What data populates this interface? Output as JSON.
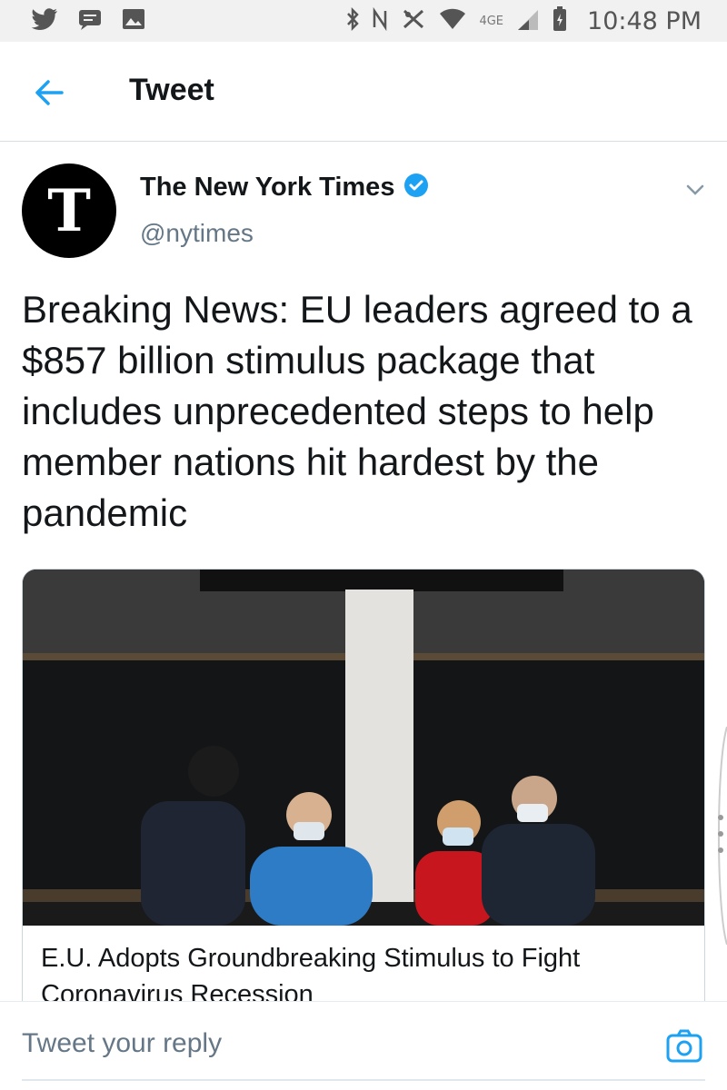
{
  "status_bar": {
    "time": "10:48 PM",
    "network": "4GE",
    "left_icons": [
      "twitter-bird-icon",
      "message-icon",
      "image-icon"
    ],
    "right_icons": [
      "bluetooth-icon",
      "nfc-icon",
      "mute-icon",
      "wifi-icon",
      "signal-icon",
      "battery-icon"
    ]
  },
  "header": {
    "title": "Tweet",
    "back_icon": "back-arrow-icon"
  },
  "tweet": {
    "author_name": "The New York Times",
    "handle": "@nytimes",
    "avatar_letter": "T",
    "verified": true,
    "text": "Breaking News: EU leaders agreed to a $857 billion stimulus package that includes unprecedented steps to help member nations hit hardest by the pandemic"
  },
  "card": {
    "title": "E.U. Adopts Groundbreaking Stimulus to Fight Coronavirus Recession"
  },
  "reply": {
    "placeholder": "Tweet your reply",
    "camera_icon": "camera-icon"
  },
  "colors": {
    "accent": "#1da1f2",
    "text": "#14171a",
    "secondary": "#657786",
    "status_bar_bg": "#f1f1f1"
  }
}
